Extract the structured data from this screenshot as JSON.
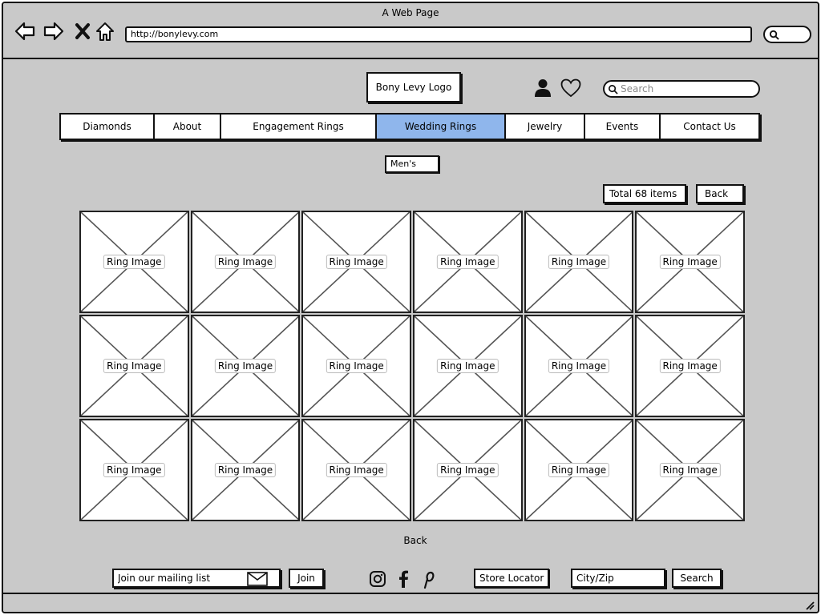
{
  "window": {
    "title": "A Web Page",
    "url": "http://bonylevy.com"
  },
  "header": {
    "logo": "Bony Levy Logo",
    "search_placeholder": "Search",
    "icons": [
      "user-icon",
      "heart-icon",
      "search-icon"
    ]
  },
  "nav": {
    "items": [
      {
        "label": "Diamonds"
      },
      {
        "label": "About"
      },
      {
        "label": "Engagement Rings"
      },
      {
        "label": "Wedding Rings",
        "active": true
      },
      {
        "label": "Jewelry"
      },
      {
        "label": "Events"
      },
      {
        "label": "Contact Us"
      }
    ],
    "active_color": "#8fb6ec"
  },
  "subcategory": "Men's",
  "listing": {
    "total": "Total 68 items",
    "back_top": "Back",
    "back_bottom": "Back",
    "rows": 3,
    "columns": 6,
    "item_label": "Ring Image"
  },
  "footer": {
    "mailing_placeholder": "Join our mailing list",
    "join": "Join",
    "social": [
      "instagram-icon",
      "facebook-icon",
      "pinterest-icon"
    ],
    "store_locator": "Store Locator",
    "zip_placeholder": "City/Zip",
    "search": "Search"
  }
}
